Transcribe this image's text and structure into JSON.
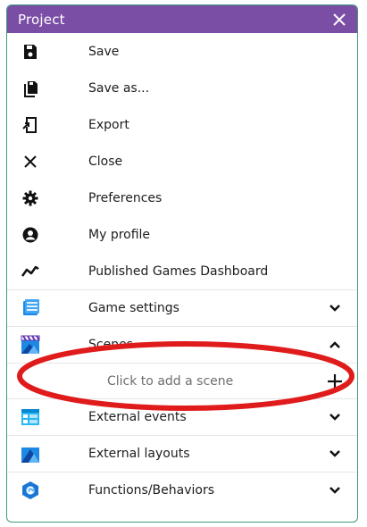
{
  "header": {
    "title": "Project",
    "close_icon": "close-icon"
  },
  "menu": {
    "items": [
      {
        "label": "Save",
        "icon": "save-icon"
      },
      {
        "label": "Save as...",
        "icon": "save-as-icon"
      },
      {
        "label": "Export",
        "icon": "export-icon"
      },
      {
        "label": "Close",
        "icon": "close-icon"
      },
      {
        "label": "Preferences",
        "icon": "gear-icon"
      },
      {
        "label": "My profile",
        "icon": "profile-icon"
      },
      {
        "label": "Published Games Dashboard",
        "icon": "analytics-icon"
      }
    ],
    "sections": [
      {
        "label": "Game settings",
        "icon": "game-settings-icon",
        "state": "collapsed"
      },
      {
        "label": "Scenes",
        "icon": "scenes-icon",
        "state": "expanded"
      },
      {
        "label": "External events",
        "icon": "external-events-icon",
        "state": "collapsed"
      },
      {
        "label": "External layouts",
        "icon": "external-layouts-icon",
        "state": "collapsed"
      },
      {
        "label": "Functions/Behaviors",
        "icon": "functions-behaviors-icon",
        "state": "collapsed"
      }
    ],
    "add_scene_label": "Click to add a scene"
  },
  "colors": {
    "title_bar": "#7b4ea6",
    "border": "#3f9a7b",
    "highlight": "#e01b1b",
    "icon_blue": "#1e88e5"
  }
}
